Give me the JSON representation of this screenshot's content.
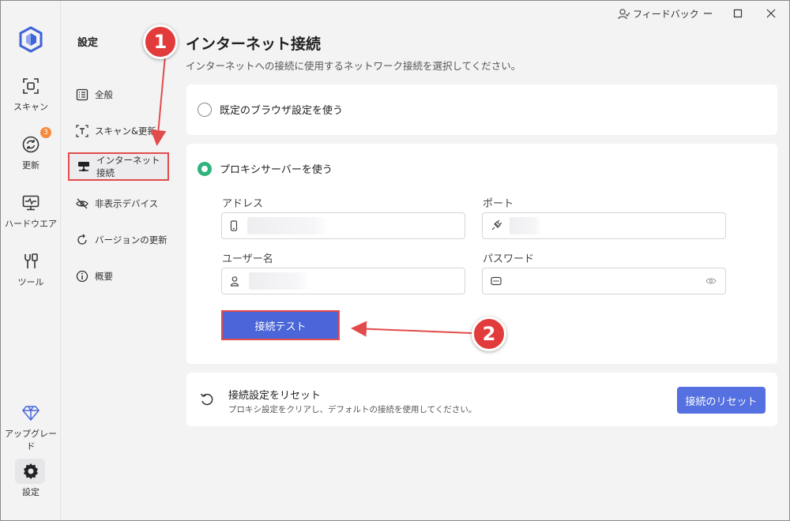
{
  "titlebar": {
    "feedback_label": "フィードバック"
  },
  "rail": {
    "items": [
      {
        "label": "スキャン"
      },
      {
        "label": "更新",
        "badge": "3"
      },
      {
        "label": "ハードウエア"
      },
      {
        "label": "ツール"
      },
      {
        "label": "アップグレード"
      },
      {
        "label": "設定"
      }
    ]
  },
  "menu": {
    "title": "設定",
    "items": [
      {
        "label": "全般"
      },
      {
        "label": "スキャン&更新"
      },
      {
        "label": "インターネット接続",
        "active": true
      },
      {
        "label": "非表示デバイス"
      },
      {
        "label": "バージョンの更新"
      },
      {
        "label": "概要"
      }
    ]
  },
  "content": {
    "title": "インターネット接続",
    "subtitle": "インターネットへの接続に使用するネットワーク接続を選択してください。",
    "option_default": "既定のブラウザ設定を使う",
    "option_proxy": "プロキシサーバーを使う",
    "address_label": "アドレス",
    "port_label": "ポート",
    "username_label": "ユーザー名",
    "password_label": "パスワード",
    "test_button": "接続テスト",
    "reset_title": "接続設定をリセット",
    "reset_desc": "プロキシ設定をクリアし、デフォルトの接続を使用してください。",
    "reset_button": "接続のリセット"
  },
  "callouts": [
    "1",
    "2"
  ],
  "colors": {
    "accent": "#4a66d8",
    "radio_on": "#2fb37c",
    "annotation": "#e24b4b",
    "badge": "#f58a3c"
  }
}
